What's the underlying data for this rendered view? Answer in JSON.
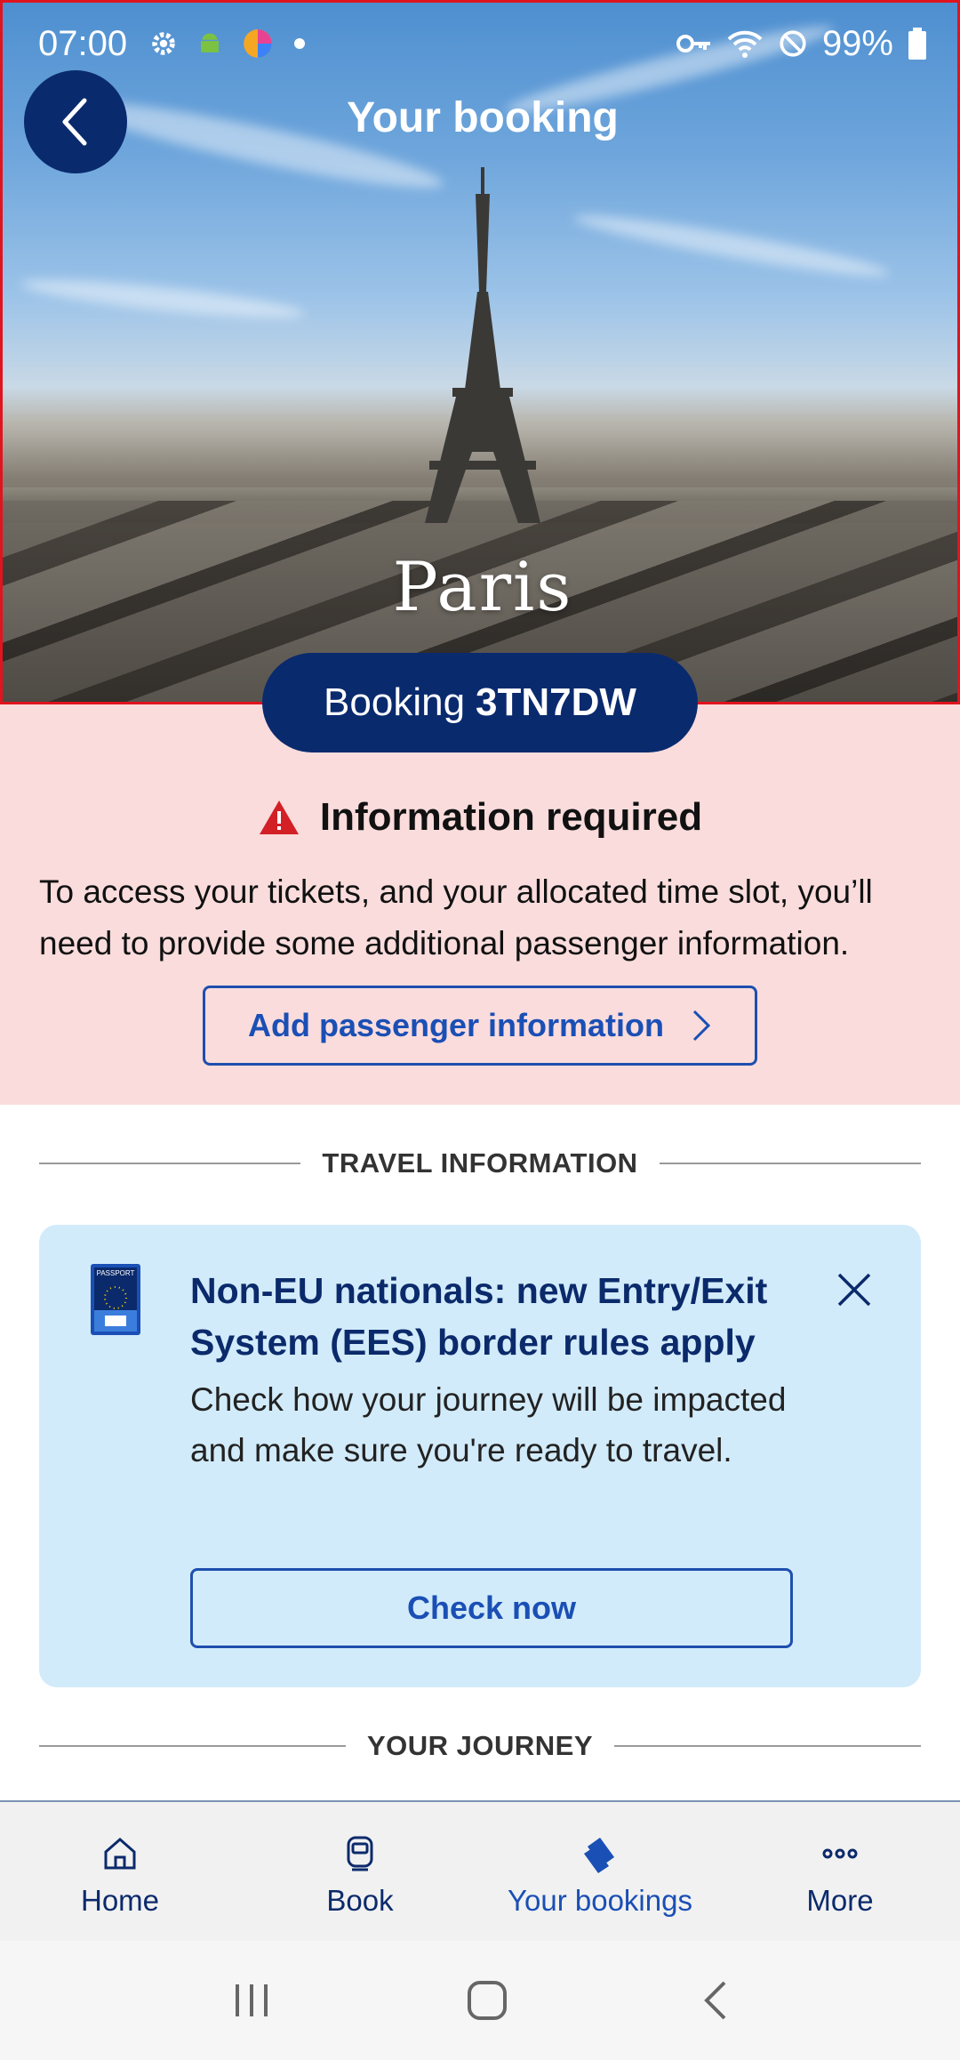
{
  "status_bar": {
    "time": "07:00",
    "battery": "99%",
    "icons": [
      "settings-icon",
      "android-icon",
      "app-icon",
      "dot-icon",
      "key-icon",
      "wifi-icon",
      "block-icon",
      "battery-icon"
    ]
  },
  "header": {
    "title": "Your booking",
    "back_icon": "chevron-left-icon"
  },
  "hero": {
    "city": "Paris"
  },
  "booking": {
    "prefix": "Booking",
    "reference": "3TN7DW"
  },
  "alert": {
    "title": "Information required",
    "text": "To access your tickets, and your allocated time slot, you’ll need to provide some additional passenger information.",
    "button_label": "Add passenger information"
  },
  "sections": {
    "travel_information": "TRAVEL INFORMATION",
    "your_journey": "YOUR JOURNEY"
  },
  "ees_card": {
    "passport_label": "PASSPORT",
    "title": "Non-EU nationals: new Entry/Exit System (EES) border rules apply",
    "body": "Check how your journey will be impacted and make sure you're ready to travel.",
    "button_label": "Check now"
  },
  "bottom_nav": {
    "items": [
      {
        "label": "Home",
        "icon": "home-icon"
      },
      {
        "label": "Book",
        "icon": "train-icon"
      },
      {
        "label": "Your bookings",
        "icon": "tickets-icon",
        "active": true
      },
      {
        "label": "More",
        "icon": "more-icon"
      }
    ]
  },
  "colors": {
    "navy": "#0a2a6e",
    "link_blue": "#1a4fb5",
    "alert_bg": "#fadcdc",
    "alert_red": "#d31f26",
    "info_card_bg": "#d2ebfa"
  }
}
